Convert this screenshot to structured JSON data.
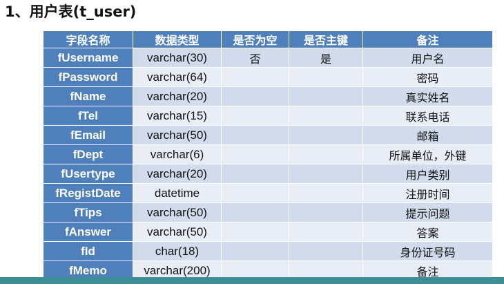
{
  "title": "1、用户表(t_user)",
  "table": {
    "headers": [
      "字段名称",
      "数据类型",
      "是否为空",
      "是否主键",
      "备注"
    ],
    "rows": [
      {
        "name": "fUsername",
        "type": "varchar(30)",
        "nullable": "否",
        "primary_key": "是",
        "note": "用户名"
      },
      {
        "name": "fPassword",
        "type": "varchar(64)",
        "nullable": "",
        "primary_key": "",
        "note": "密码"
      },
      {
        "name": "fName",
        "type": "varchar(20)",
        "nullable": "",
        "primary_key": "",
        "note": "真实姓名"
      },
      {
        "name": "fTel",
        "type": "varchar(15)",
        "nullable": "",
        "primary_key": "",
        "note": "联系电话"
      },
      {
        "name": "fEmail",
        "type": "varchar(50)",
        "nullable": "",
        "primary_key": "",
        "note": "邮箱"
      },
      {
        "name": "fDept",
        "type": "varchar(6)",
        "nullable": "",
        "primary_key": "",
        "note": "所属单位，外键"
      },
      {
        "name": "fUsertype",
        "type": "varchar(20)",
        "nullable": "",
        "primary_key": "",
        "note": "用户类别"
      },
      {
        "name": "fRegistDate",
        "type": "datetime",
        "nullable": "",
        "primary_key": "",
        "note": "注册时间"
      },
      {
        "name": "fTips",
        "type": "varchar(50)",
        "nullable": "",
        "primary_key": "",
        "note": "提示问题"
      },
      {
        "name": "fAnswer",
        "type": "varchar(50)",
        "nullable": "",
        "primary_key": "",
        "note": "答案"
      },
      {
        "name": "fId",
        "type": "char(18)",
        "nullable": "",
        "primary_key": "",
        "note": "身份证号码"
      },
      {
        "name": "fMemo",
        "type": "varchar(200)",
        "nullable": "",
        "primary_key": "",
        "note": "备注"
      }
    ]
  },
  "colors": {
    "header_bg": "#4f80bc",
    "row_odd_bg": "#d1dbec",
    "row_even_bg": "#e9eef6",
    "bottom_bar": "#3e8f95"
  }
}
